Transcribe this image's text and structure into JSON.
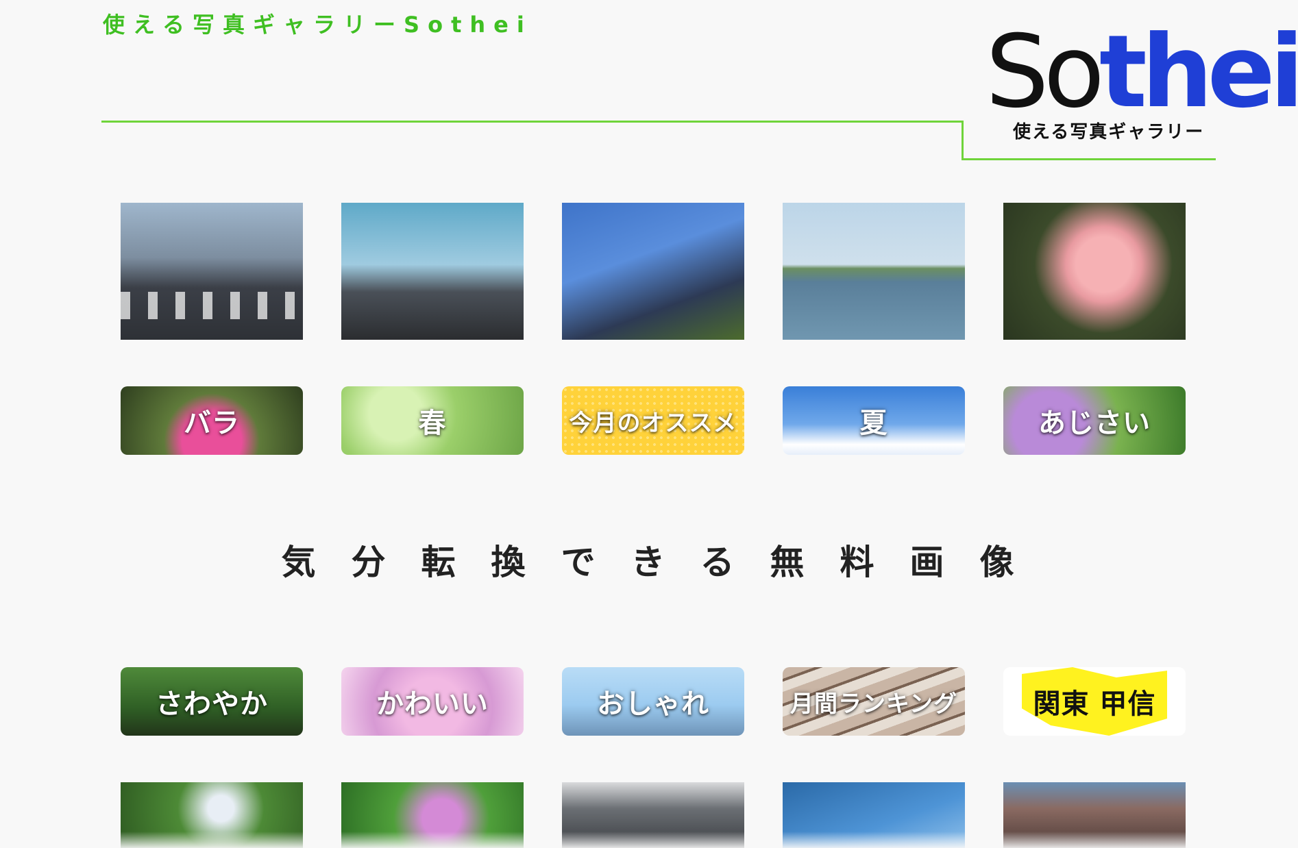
{
  "header": {
    "site_title": "使える写真ギャラリーSothei",
    "logo": {
      "word_s": "So",
      "word_thei": "thei",
      "subtitle": "使える写真ギャラリー"
    }
  },
  "tagline": "気分転換できる無料画像",
  "featured_photos": [
    {
      "name": "city-street-photo"
    },
    {
      "name": "sun-buildings-photo"
    },
    {
      "name": "skyscrapers-photo"
    },
    {
      "name": "island-photo"
    },
    {
      "name": "pink-rose-photo"
    }
  ],
  "category_buttons_row1": [
    {
      "label": "バラ"
    },
    {
      "label": "春"
    },
    {
      "label": "今月のオススメ"
    },
    {
      "label": "夏"
    },
    {
      "label": "あじさい"
    }
  ],
  "category_buttons_row2": [
    {
      "label": "さわやか"
    },
    {
      "label": "かわいい"
    },
    {
      "label": "おしゃれ"
    },
    {
      "label": "月間ランキング"
    },
    {
      "label": "関東 甲信"
    }
  ],
  "colors": {
    "brand_green": "#3fbf22",
    "line_green": "#6fd43a",
    "logo_blue": "#1f3fd6",
    "recommend_yellow": "#ffd23a"
  }
}
